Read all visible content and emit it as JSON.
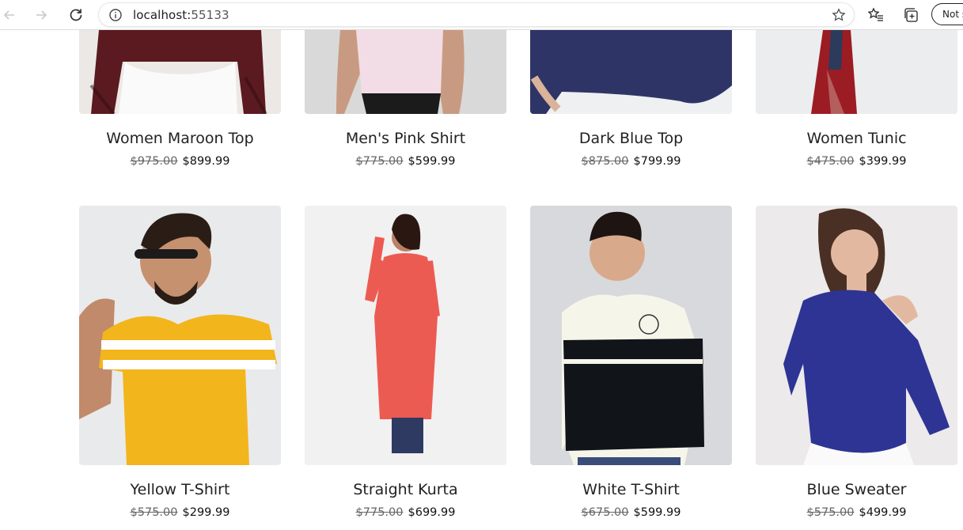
{
  "browser": {
    "url_host": "localhost:",
    "url_port": "55133",
    "profile_label": "Not s"
  },
  "products": [
    {
      "name": "Women Maroon Top",
      "old_price": "$975.00",
      "price": "$899.99",
      "bg": "#ece8e6",
      "garment": "#5a1a1f",
      "icon": "maroon-top-photo"
    },
    {
      "name": "Men's Pink Shirt",
      "old_price": "$775.00",
      "price": "$599.99",
      "bg": "#d9d9d9",
      "garment": "#f2dde6",
      "icon": "pink-shirt-photo"
    },
    {
      "name": "Dark Blue Top",
      "old_price": "$875.00",
      "price": "$799.99",
      "bg": "#eef0f2",
      "garment": "#2e3566",
      "icon": "dark-blue-top-photo"
    },
    {
      "name": "Women Tunic",
      "old_price": "$475.00",
      "price": "$399.99",
      "bg": "#ecedef",
      "garment": "#9c1c24",
      "icon": "tunic-photo"
    },
    {
      "name": "Yellow T-Shirt",
      "old_price": "$575.00",
      "price": "$299.99",
      "bg": "#e9eaec",
      "garment": "#f2b51c",
      "icon": "yellow-tshirt-photo"
    },
    {
      "name": "Straight Kurta",
      "old_price": "$775.00",
      "price": "$699.99",
      "bg": "#f1f1f1",
      "garment": "#ec5b52",
      "icon": "kurta-photo"
    },
    {
      "name": "White T-Shirt",
      "old_price": "$675.00",
      "price": "$599.99",
      "bg": "#d8d9dc",
      "garment": "#111419",
      "icon": "white-tshirt-photo"
    },
    {
      "name": "Blue Sweater",
      "old_price": "$575.00",
      "price": "$499.99",
      "bg": "#eceaeb",
      "garment": "#2e3494",
      "icon": "blue-sweater-photo"
    }
  ]
}
